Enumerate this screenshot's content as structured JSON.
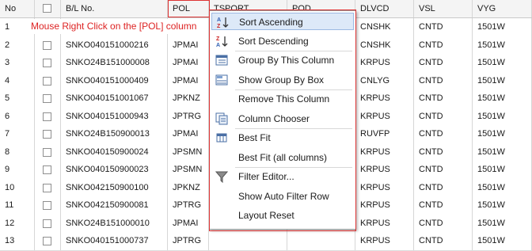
{
  "grid": {
    "columns": [
      "No",
      "",
      "B/L No.",
      "POL",
      "TSPORT",
      "POD",
      "DLVCD",
      "VSL",
      "VYG"
    ],
    "rows": [
      [
        "1",
        "",
        "",
        "",
        "",
        "",
        "CNSHK",
        "CNTD",
        "1501W"
      ],
      [
        "2",
        "",
        "SNKO040151000216",
        "JPMAI",
        "",
        "",
        "CNSHK",
        "CNTD",
        "1501W"
      ],
      [
        "3",
        "",
        "SNKO24B151000008",
        "JPMAI",
        "",
        "",
        "KRPUS",
        "CNTD",
        "1501W"
      ],
      [
        "4",
        "",
        "SNKO040151000409",
        "JPMAI",
        "",
        "",
        "CNLYG",
        "CNTD",
        "1501W"
      ],
      [
        "5",
        "",
        "SNKO040151001067",
        "JPKNZ",
        "",
        "",
        "KRPUS",
        "CNTD",
        "1501W"
      ],
      [
        "6",
        "",
        "SNKO040151000943",
        "JPTRG",
        "",
        "",
        "KRPUS",
        "CNTD",
        "1501W"
      ],
      [
        "7",
        "",
        "SNKO24B150900013",
        "JPMAI",
        "",
        "",
        "RUVFP",
        "CNTD",
        "1501W"
      ],
      [
        "8",
        "",
        "SNKO040150900024",
        "JPSMN",
        "",
        "",
        "KRPUS",
        "CNTD",
        "1501W"
      ],
      [
        "9",
        "",
        "SNKO040150900023",
        "JPSMN",
        "",
        "",
        "KRPUS",
        "CNTD",
        "1501W"
      ],
      [
        "10",
        "",
        "SNKO042150900100",
        "JPKNZ",
        "",
        "",
        "KRPUS",
        "CNTD",
        "1501W"
      ],
      [
        "11",
        "",
        "SNKO042150900081",
        "JPTRG",
        "",
        "",
        "KRPUS",
        "CNTD",
        "1501W"
      ],
      [
        "12",
        "",
        "SNKO24B151000010",
        "JPMAI",
        "",
        "",
        "KRPUS",
        "CNTD",
        "1501W"
      ],
      [
        "13",
        "",
        "SNKO040151000737",
        "JPTRG",
        "",
        "",
        "KRPUS",
        "CNTD",
        "1501W"
      ]
    ]
  },
  "hint_text": "Mouse Right Click on the [POL] column",
  "menu": {
    "items": [
      {
        "label": "Sort Ascending",
        "icon": "sort-ascending-icon",
        "highlighted": true
      },
      {
        "label": "Sort Descending",
        "icon": "sort-descending-icon"
      },
      {
        "label": "Group By This Column",
        "icon": "group-by-icon"
      },
      {
        "label": "Show Group By Box",
        "icon": "group-box-icon"
      },
      {
        "label": "Remove This Column",
        "icon": ""
      },
      {
        "label": "Column Chooser",
        "icon": "column-chooser-icon"
      },
      {
        "label": "Best Fit",
        "icon": "best-fit-icon"
      },
      {
        "label": "Best Fit (all columns)",
        "icon": ""
      },
      {
        "label": "Filter Editor...",
        "icon": "filter-icon"
      },
      {
        "label": "Show Auto Filter Row",
        "icon": ""
      },
      {
        "label": "Layout Reset",
        "icon": ""
      }
    ]
  },
  "colors": {
    "highlight": "#dde9f8",
    "hint_red": "#dd2222",
    "icon_blue": "#2f5fb3",
    "icon_red": "#cc2222"
  }
}
